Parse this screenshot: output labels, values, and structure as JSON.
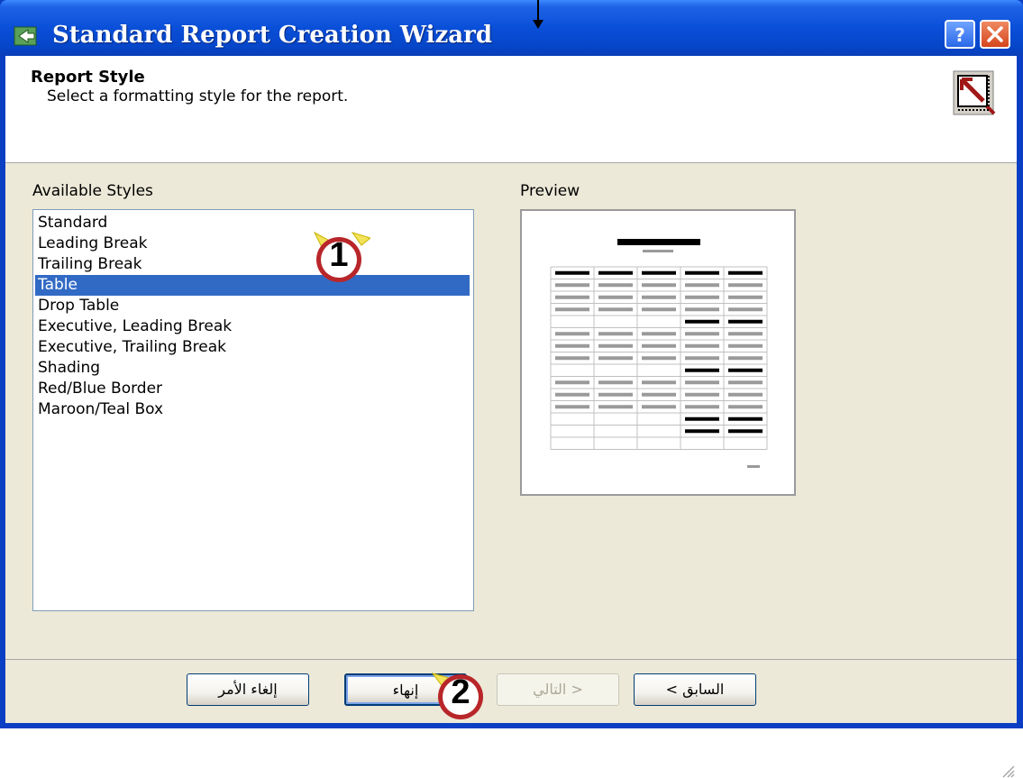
{
  "window": {
    "title": "Standard Report Creation Wizard",
    "help_icon": "help-icon",
    "close_icon": "close-icon"
  },
  "header": {
    "title": "Report Style",
    "subtitle": "Select a formatting style for the report.",
    "icon": "report-style-icon"
  },
  "styles": {
    "label": "Available Styles",
    "items": [
      "Standard",
      "Leading Break",
      "Trailing Break",
      "Table",
      "Drop Table",
      "Executive, Leading Break",
      "Executive, Trailing Break",
      "Shading",
      "Red/Blue Border",
      "Maroon/Teal Box"
    ],
    "selected": "Table"
  },
  "preview": {
    "label": "Preview"
  },
  "buttons": {
    "cancel": "إلغاء الأمر",
    "finish": "إنهاء",
    "next": "التالي >",
    "back": "< السابق"
  },
  "callouts": {
    "one": "1",
    "two": "2"
  },
  "colors": {
    "titlebar": "#0a4fd8",
    "selection": "#316ac5",
    "dialog_bg": "#ece9d8"
  }
}
